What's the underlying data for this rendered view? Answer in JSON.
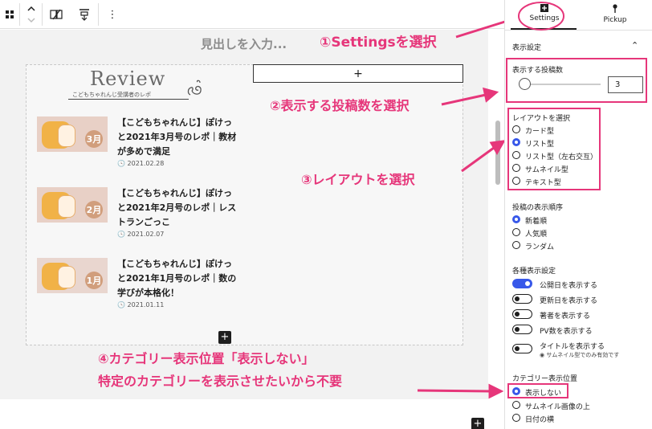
{
  "toolbar": {
    "icons": [
      "block-grid-icon",
      "move-updown-icon",
      "transform-icon",
      "align-icon",
      "more-options-icon"
    ]
  },
  "canvas": {
    "heading_placeholder": "見出しを入力...",
    "add_button": "+",
    "review_logo": {
      "word": "Review",
      "subtitle": "こどもちゃれんじ受講者のレポ"
    },
    "posts": [
      {
        "title": "【こどもちゃれんじ】ぽけっと2021年3月号のレポ｜教材が多めで満足",
        "date": "2021.02.28",
        "thumb_badge": "3月"
      },
      {
        "title": "【こどもちゃれんじ】ぽけっと2021年2月号のレポ｜レストランごっこ",
        "date": "2021.02.07",
        "thumb_badge": "2月"
      },
      {
        "title": "【こどもちゃれんじ】ぽけっと2021年1月号のレポ｜数の学びが本格化！",
        "date": "2021.01.11",
        "thumb_badge": "1月"
      }
    ],
    "inserter_label": "+"
  },
  "annotations": {
    "a1": "①Settingsを選択",
    "a2": "②表示する投稿数を選択",
    "a3": "③レイアウトを選択",
    "a4_line1": "④カテゴリー表示位置「表示しない」",
    "a4_line2": "特定のカテゴリーを表示させたいから不要",
    "color": "#e6367a"
  },
  "sidebar": {
    "tabs": [
      {
        "label": "Settings",
        "icon": "settings-icon",
        "active": true
      },
      {
        "label": "Pickup",
        "icon": "pin-icon",
        "active": false
      }
    ],
    "section_title": "表示設定",
    "post_count": {
      "label": "表示する投稿数",
      "value": "3"
    },
    "layout": {
      "label": "レイアウトを選択",
      "options": [
        "カード型",
        "リスト型",
        "リスト型（左右交互）",
        "サムネイル型",
        "テキスト型"
      ],
      "selected": "リスト型"
    },
    "order": {
      "label": "投稿の表示順序",
      "options": [
        "新着順",
        "人気順",
        "ランダム"
      ],
      "selected": "新着順"
    },
    "display": {
      "label": "各種表示設定",
      "toggles": [
        {
          "label": "公開日を表示する",
          "on": true
        },
        {
          "label": "更新日を表示する",
          "on": false
        },
        {
          "label": "著者を表示する",
          "on": false
        },
        {
          "label": "PV数を表示する",
          "on": false
        },
        {
          "label": "タイトルを表示する",
          "on": false,
          "note": "サムネイル型でのみ有効です"
        }
      ]
    },
    "category_position": {
      "label": "カテゴリー表示位置",
      "options": [
        "表示しない",
        "サムネイル画像の上",
        "日付の横"
      ],
      "selected": "表示しない"
    }
  },
  "colors": {
    "accent": "#3858e9",
    "annotation": "#e6367a"
  }
}
